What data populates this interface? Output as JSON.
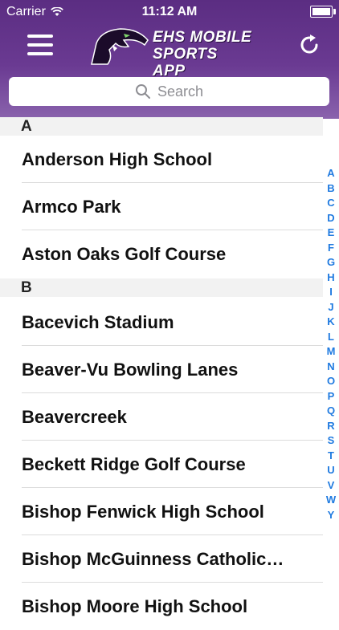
{
  "status_bar": {
    "carrier": "Carrier",
    "time": "11:12 AM"
  },
  "header": {
    "logo_line1": "EHS MOBILE",
    "logo_line2": "SPORTS APP"
  },
  "search": {
    "placeholder": "Search"
  },
  "sections": [
    {
      "letter": "A",
      "items": [
        "Anderson High School",
        "Armco Park",
        "Aston Oaks Golf Course"
      ]
    },
    {
      "letter": "B",
      "items": [
        "Bacevich Stadium",
        "Beaver-Vu Bowling Lanes",
        "Beavercreek",
        "Beckett Ridge Golf Course",
        "Bishop Fenwick High School",
        "Bishop McGuinness Catholic…",
        "Bishop Moore High School"
      ]
    }
  ],
  "index": [
    "A",
    "B",
    "C",
    "D",
    "E",
    "F",
    "G",
    "H",
    "I",
    "J",
    "K",
    "L",
    "M",
    "N",
    "O",
    "P",
    "Q",
    "R",
    "S",
    "T",
    "U",
    "V",
    "W",
    "Y"
  ],
  "colors": {
    "header": "#5b2d82",
    "index": "#1f7ae0"
  }
}
